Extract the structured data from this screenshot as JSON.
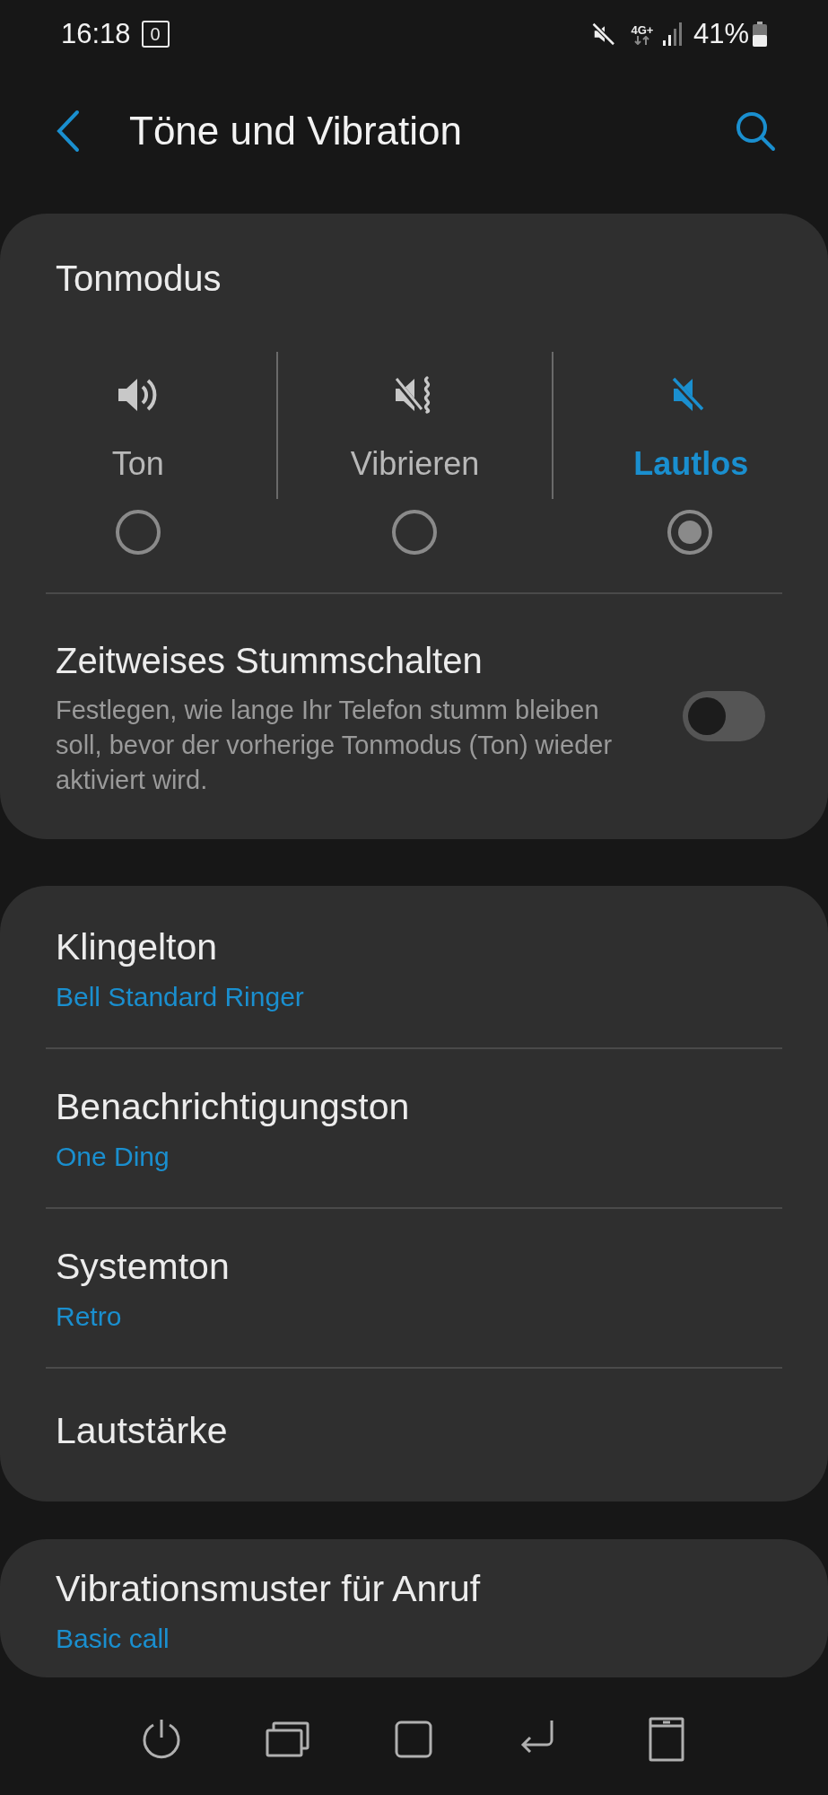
{
  "status_bar": {
    "time": "16:18",
    "notification_count": "0",
    "network": "4G+",
    "battery": "41%"
  },
  "header": {
    "title": "Töne und Vibration"
  },
  "sound_mode": {
    "title": "Tonmodus",
    "options": [
      {
        "kind": "sound",
        "label": "Ton",
        "selected": false
      },
      {
        "kind": "vibrate",
        "label": "Vibrieren",
        "selected": false
      },
      {
        "kind": "mute",
        "label": "Lautlos",
        "selected": true
      }
    ],
    "temporary_mute": {
      "title": "Zeitweises Stummschalten",
      "description": "Festlegen, wie lange Ihr Telefon stumm bleiben soll, bevor der vorherige Tonmodus (Ton) wieder aktiviert wird.",
      "on": false
    }
  },
  "sound_settings": [
    {
      "title": "Klingelton",
      "value": "Bell Standard Ringer"
    },
    {
      "title": "Benachrichtigungston",
      "value": "One Ding"
    },
    {
      "title": "Systemton",
      "value": "Retro"
    },
    {
      "title": "Lautstärke"
    }
  ],
  "vibration_settings": [
    {
      "title": "Vibrationsmuster für Anruf",
      "value": "Basic call"
    }
  ],
  "nav_bar": [
    {
      "kind": "power"
    },
    {
      "kind": "recents"
    },
    {
      "kind": "home"
    },
    {
      "kind": "back"
    },
    {
      "kind": "device"
    }
  ]
}
